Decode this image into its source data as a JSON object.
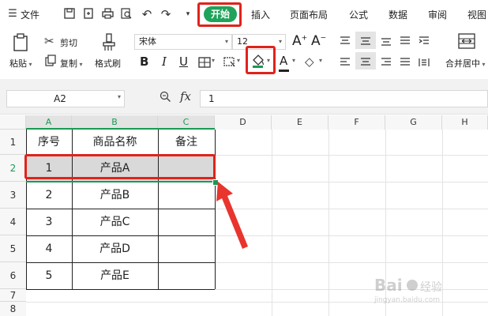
{
  "menu": {
    "file_label": "文件",
    "tabs": [
      "开始",
      "插入",
      "页面布局",
      "公式",
      "数据",
      "审阅",
      "视图"
    ]
  },
  "toolbar": {
    "paste_label": "粘贴",
    "cut_label": "剪切",
    "copy_label": "复制",
    "format_painter_label": "格式刷",
    "font_name": "宋体",
    "font_size": "12",
    "merge_center_label": "合并居中"
  },
  "formula_bar": {
    "name_box": "A2",
    "fx_label": "fx",
    "value": "1"
  },
  "sheet": {
    "columns": [
      "A",
      "B",
      "C",
      "D",
      "E",
      "F",
      "G",
      "H"
    ],
    "row_numbers": [
      "1",
      "2",
      "3",
      "4",
      "5",
      "6",
      "7",
      "8"
    ],
    "header_row": [
      "序号",
      "商品名称",
      "备注"
    ],
    "rows": [
      [
        "1",
        "产品A",
        ""
      ],
      [
        "2",
        "产品B",
        ""
      ],
      [
        "3",
        "产品C",
        ""
      ],
      [
        "4",
        "产品D",
        ""
      ],
      [
        "5",
        "产品E",
        ""
      ]
    ],
    "selected_row": "2",
    "selected_fill_color": "#d9d9d9"
  },
  "watermark": "Baidu 经验 jingyan.baidu.com",
  "colors": {
    "accent_green": "#1fa35a",
    "highlight_red": "#e0231b"
  }
}
